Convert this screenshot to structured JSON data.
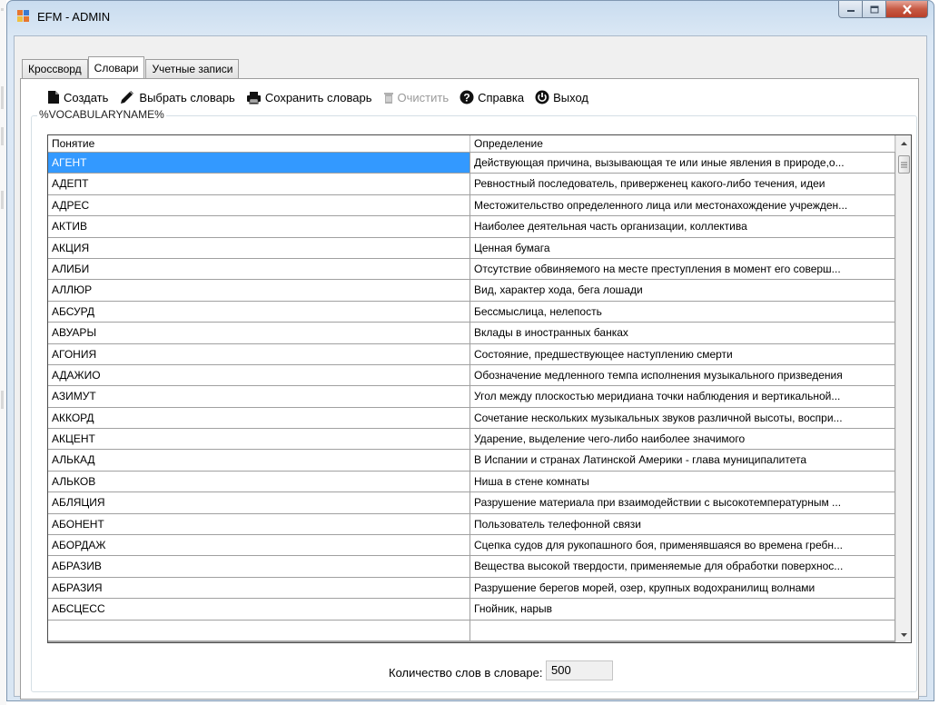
{
  "window": {
    "title": "EFM - ADMIN"
  },
  "tabs": [
    "Кроссворд",
    "Словари",
    "Учетные записи"
  ],
  "active_tab": 1,
  "toolbar": {
    "create": "Создать",
    "select": "Выбрать словарь",
    "save": "Сохранить словарь",
    "clear": "Очистить",
    "help": "Справка",
    "exit": "Выход"
  },
  "group_title": "%VOCABULARYNAME%",
  "grid": {
    "columns": [
      "Понятие",
      "Определение"
    ],
    "selected_row": 0,
    "rows": [
      [
        "АГЕНТ",
        "Действующая причина, вызывающая те или иные явления в природе,о..."
      ],
      [
        "АДЕПТ",
        "Ревностный последователь, приверженец какого-либо течения, идеи"
      ],
      [
        "АДРЕС",
        "Местожительство определенного лица или местонахождение учрежден..."
      ],
      [
        "АКТИВ",
        "Наиболее деятельная часть организации, коллектива"
      ],
      [
        "АКЦИЯ",
        "Ценная бумага"
      ],
      [
        "АЛИБИ",
        "Отсутствие обвиняемого на месте преступления в момент его соверш..."
      ],
      [
        "АЛЛЮР",
        "Вид, характер хода, бега лошади"
      ],
      [
        "АБСУРД",
        "Бессмыслица, нелепость"
      ],
      [
        "АВУАРЫ",
        "Вклады в иностранных банках"
      ],
      [
        "АГОНИЯ",
        "Состояние, предшествующее наступлению смерти"
      ],
      [
        "АДАЖИО",
        "Обозначение медленного темпа исполнения музыкального призведения"
      ],
      [
        "АЗИМУТ",
        "Угол между плоскостью меридиана точки наблюдения и вертикальной..."
      ],
      [
        "АККОРД",
        "Сочетание нескольких музыкальных звуков различной высоты, воспри..."
      ],
      [
        "АКЦЕНТ",
        "Ударение, выделение чего-либо наиболее значимого"
      ],
      [
        "АЛЬКАД",
        "В Испании и странах Латинской Америки - глава муниципалитета"
      ],
      [
        "АЛЬКОВ",
        "Ниша в стене комнаты"
      ],
      [
        "АБЛЯЦИЯ",
        "Разрушение материала при взаимодействии с высокотемпературным ..."
      ],
      [
        "АБОНЕНТ",
        "Пользователь телефонной связи"
      ],
      [
        "АБОРДАЖ",
        "Сцепка судов для рукопашного боя, применявшаяся во времена гребн..."
      ],
      [
        "АБРАЗИВ",
        "Вещества высокой твердости, применяемые для обработки поверхнос..."
      ],
      [
        "АБРАЗИЯ",
        "Разрушение берегов морей, озер, крупных водохранилищ волнами"
      ],
      [
        "АБСЦЕСС",
        "Гнойник, нарыв"
      ],
      [
        "",
        ""
      ]
    ]
  },
  "footer": {
    "count_label": "Количество слов в словаре:",
    "count_value": "500"
  },
  "colors": {
    "selection": "#3399ff",
    "close_button": "#c75a44"
  }
}
